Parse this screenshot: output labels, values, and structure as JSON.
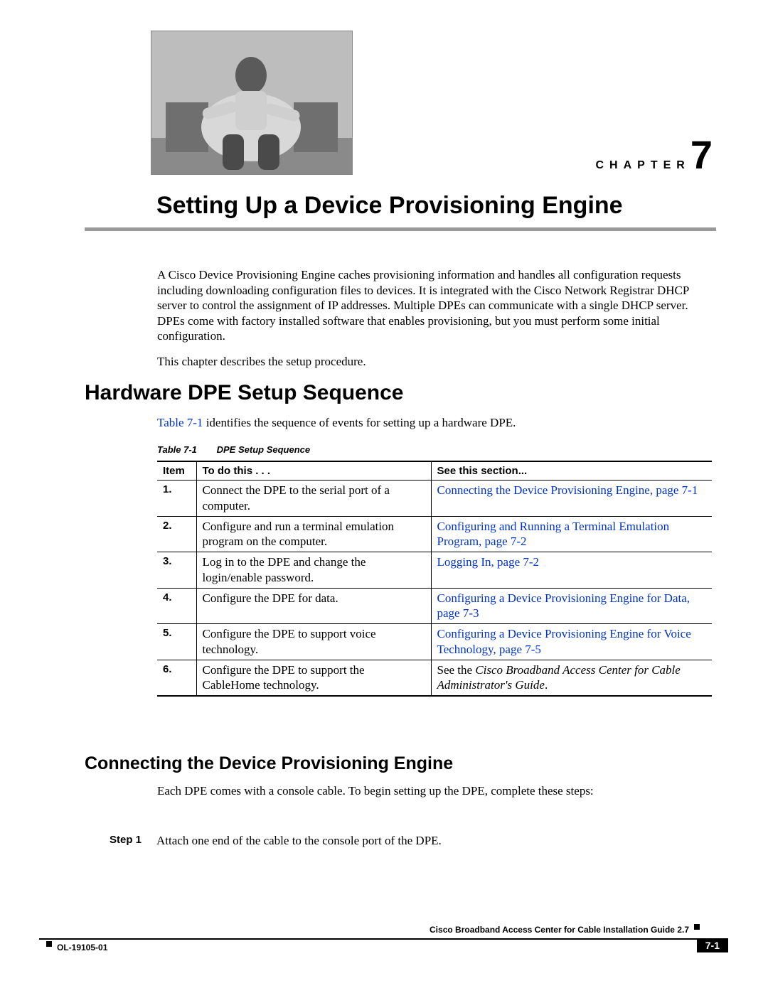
{
  "chapter": {
    "label": "CHAPTER",
    "number": "7"
  },
  "title": "Setting Up a Device Provisioning Engine",
  "intro": {
    "p1": "A Cisco Device Provisioning Engine caches provisioning information and handles all configuration requests including downloading configuration files to devices. It is integrated with the Cisco Network Registrar DHCP server to control the assignment of IP addresses. Multiple DPEs can communicate with a single DHCP server. DPEs come with factory installed software that enables provisioning, but you must perform some initial configuration.",
    "p2": "This chapter describes the setup procedure."
  },
  "section1": {
    "heading": "Hardware DPE Setup Sequence",
    "lead_pre": "Table 7-1",
    "lead_post": " identifies the sequence of events for setting up a hardware DPE."
  },
  "table": {
    "caption_num": "Table 7-1",
    "caption_title": "DPE Setup Sequence",
    "head": {
      "c1": "Item",
      "c2": "To do this . . .",
      "c3": "See this section..."
    },
    "rows": [
      {
        "n": "1.",
        "todo": "Connect the DPE to the serial port of a computer.",
        "see_link": "Connecting the Device Provisioning Engine, page 7-1",
        "see_plain_pre": "",
        "see_plain_post": ""
      },
      {
        "n": "2.",
        "todo": "Configure and run a terminal emulation program on the computer.",
        "see_link": "Configuring and Running a Terminal Emulation Program, page 7-2",
        "see_plain_pre": "",
        "see_plain_post": ""
      },
      {
        "n": "3.",
        "todo": "Log in to the DPE and change the login/enable password.",
        "see_link": "Logging In, page 7-2",
        "see_plain_pre": "",
        "see_plain_post": ""
      },
      {
        "n": "4.",
        "todo": "Configure the DPE for data.",
        "see_link": "Configuring a Device Provisioning Engine for Data, page 7-3",
        "see_plain_pre": "",
        "see_plain_post": ""
      },
      {
        "n": "5.",
        "todo": "Configure the DPE to support voice technology.",
        "see_link": "Configuring a Device Provisioning Engine for Voice Technology, page 7-5",
        "see_plain_pre": "",
        "see_plain_post": ""
      },
      {
        "n": "6.",
        "todo": "Configure the DPE to support the CableHome technology.",
        "see_link": "",
        "see_plain_pre": "See the ",
        "see_italic": "Cisco Broadband Access Center for Cable Administrator's Guide",
        "see_plain_post": "."
      }
    ]
  },
  "section2": {
    "heading": "Connecting the Device Provisioning Engine",
    "lead": "Each DPE comes with a console cable. To begin setting up the DPE, complete these steps:"
  },
  "steps": [
    {
      "label": "Step 1",
      "text": "Attach one end of the cable to the console port of the DPE."
    }
  ],
  "footer": {
    "book": "Cisco Broadband Access Center for Cable Installation Guide 2.7",
    "doc_id": "OL-19105-01",
    "page": "7-1"
  }
}
